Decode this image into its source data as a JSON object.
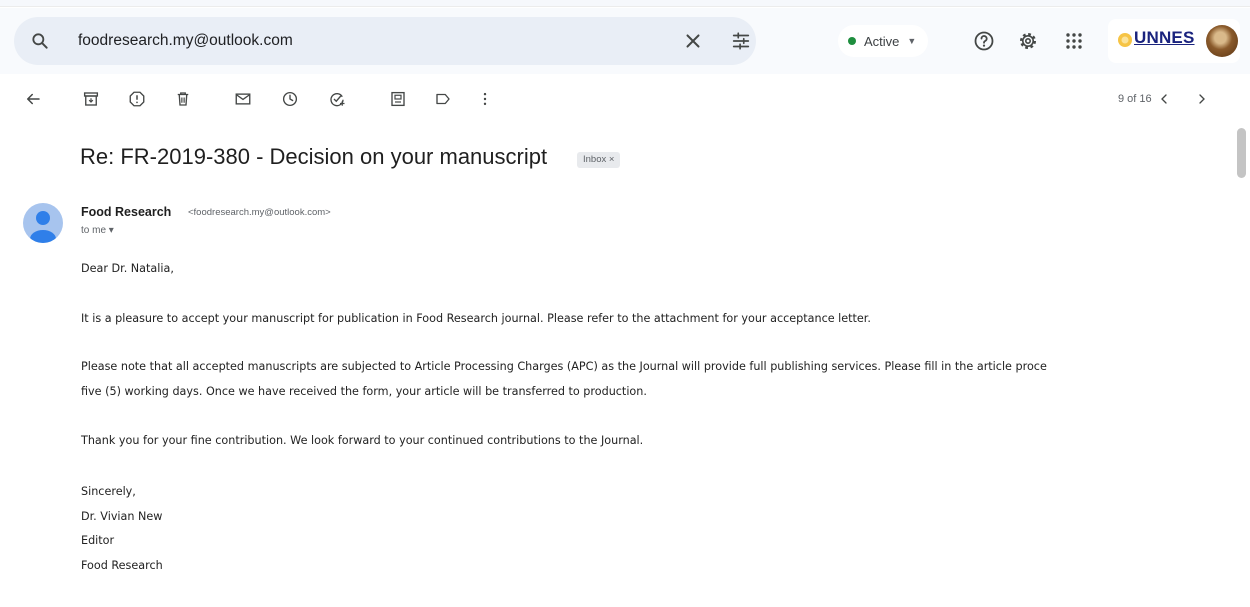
{
  "header": {
    "search": {
      "value": "foodresearch.my@outlook.com",
      "placeholder": ""
    },
    "status": {
      "label": "Active"
    },
    "brand": {
      "text": "UNNES"
    }
  },
  "toolbar": {
    "pager": "9 of 16"
  },
  "message": {
    "subject": "Re: FR-2019-380 - Decision on your manuscript",
    "label_badge": "Inbox ×",
    "sender_name": "Food Research",
    "sender_email": "<foodresearch.my@outlook.com>",
    "to_line": "to me",
    "body": [
      "Dear Dr. Natalia,",
      "It is a pleasure to accept your manuscript for publication in Food Research journal. Please refer to the attachment for your acceptance letter.",
      "Please note that all accepted manuscripts are subjected to Article Processing Charges (APC) as the Journal will provide full publishing services. Please fill in the article proce",
      "five (5) working days. Once we have received the form, your article will be transferred to production.",
      "Thank you for your fine contribution. We look forward to your continued contributions to the Journal.",
      "Sincerely,",
      "Dr. Vivian New",
      "Editor",
      "Food Research"
    ]
  },
  "icons": {
    "search": "search-icon",
    "clear": "close-icon",
    "tune": "tune-icon",
    "help": "help-icon",
    "settings": "gear-icon",
    "apps": "apps-grid-icon",
    "back": "arrow-back-icon",
    "archive": "archive-icon",
    "report": "report-spam-icon",
    "delete": "trash-icon",
    "unread": "mail-icon",
    "snooze": "clock-icon",
    "task": "add-task-icon",
    "move": "move-to-icon",
    "label": "label-icon",
    "more": "more-vert-icon",
    "prev": "chevron-left-icon",
    "next": "chevron-right-icon"
  },
  "colors": {
    "status_green": "#1e8e3e",
    "search_bg": "#e9eef6",
    "avatar_bg": "#a7c4ee",
    "brand_blue": "#1a237e"
  }
}
